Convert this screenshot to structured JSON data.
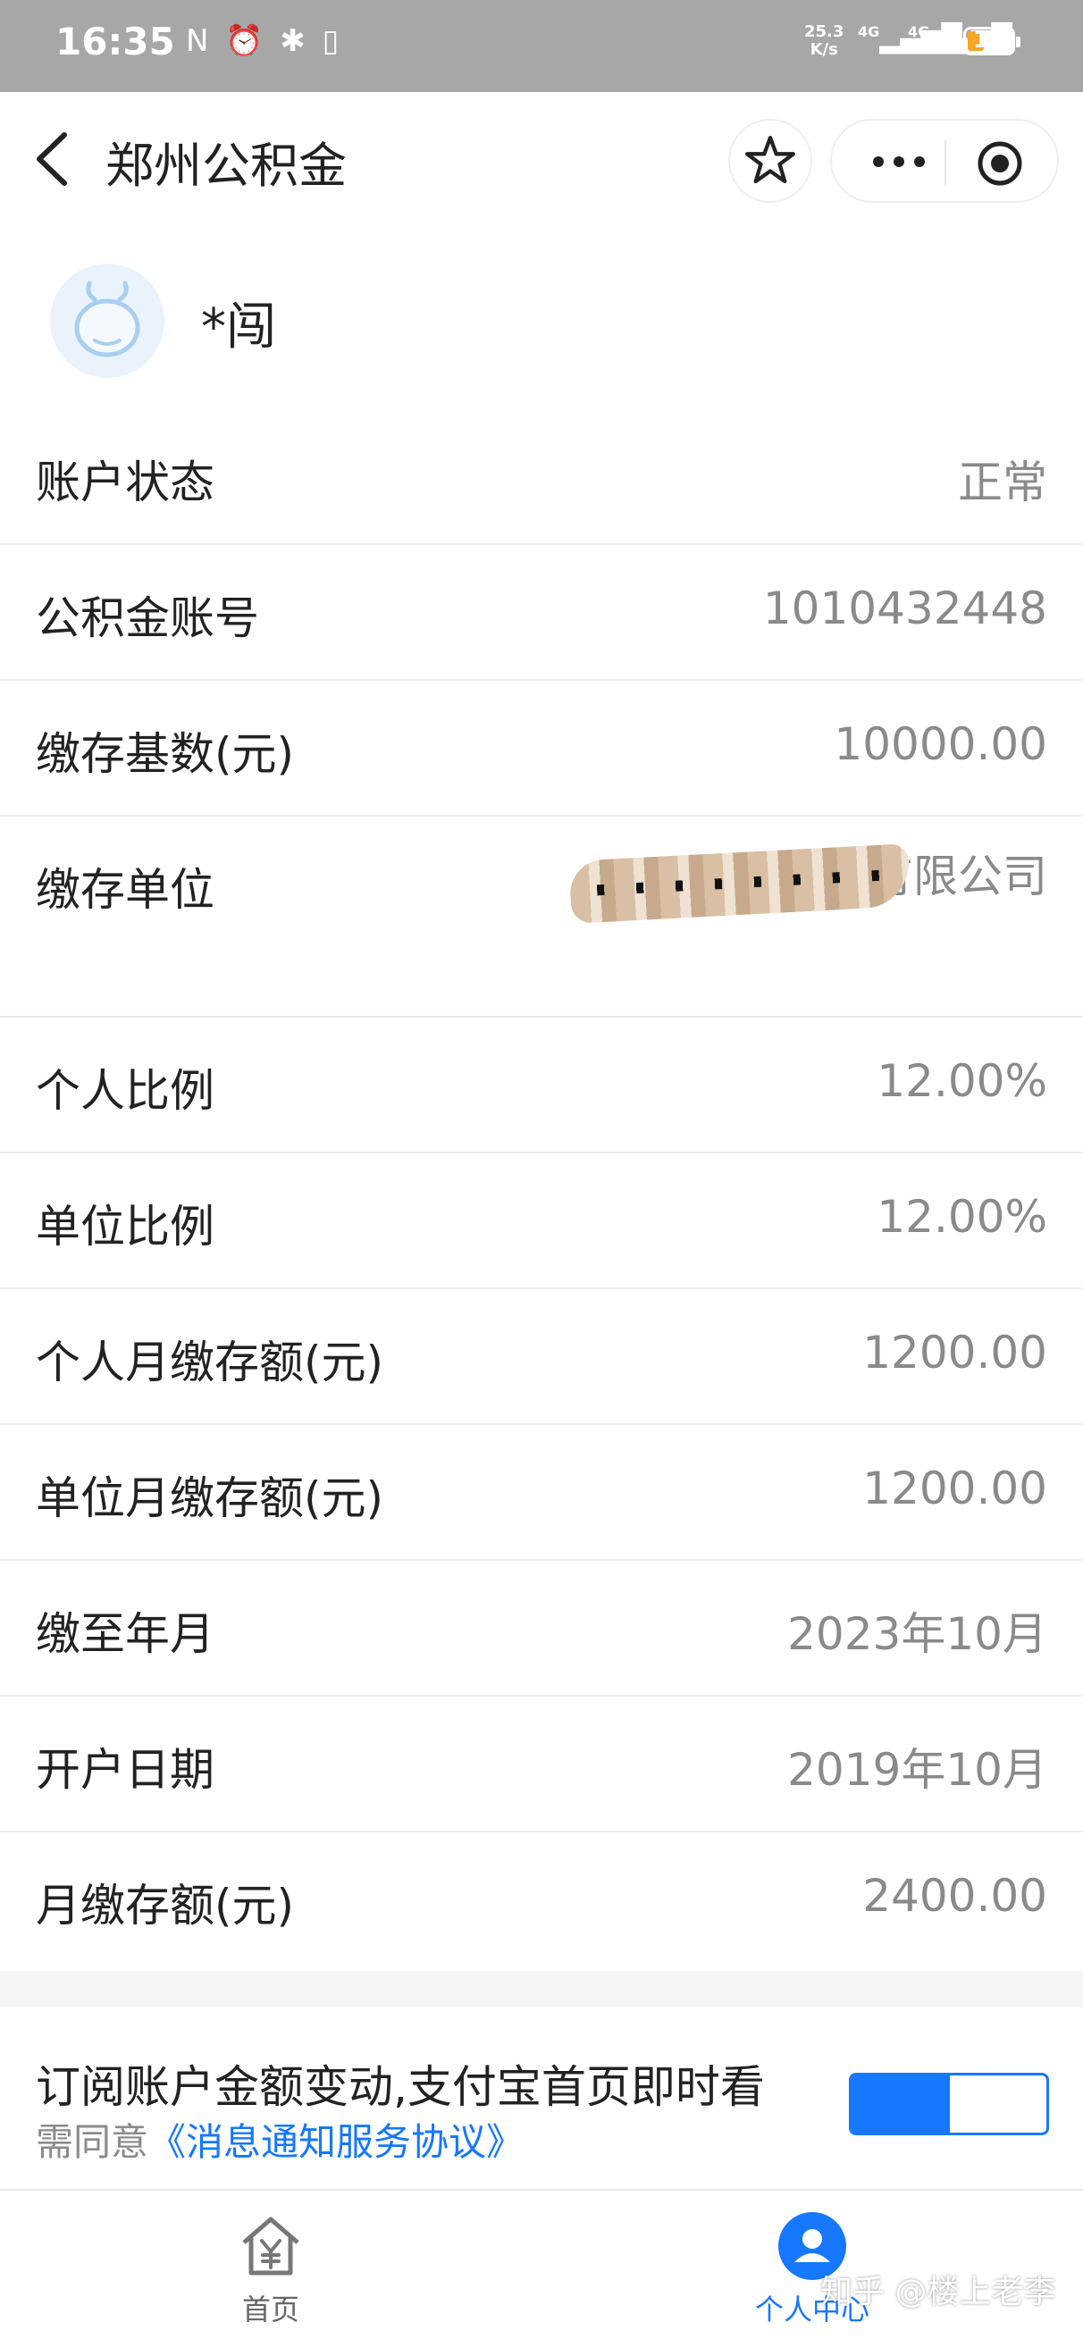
{
  "status_bar": {
    "time": "16:35",
    "left_icons": "N ⏰ ✱ ▯",
    "speed_value": "25.3",
    "speed_unit": "K/s",
    "network1": "4G",
    "network2": "4G",
    "battery": "18"
  },
  "nav": {
    "title": "郑州公积金",
    "icons": [
      "back-icon",
      "star-icon",
      "more-icon",
      "target-icon"
    ]
  },
  "user": {
    "name": "*闯"
  },
  "rows": [
    {
      "label": "账户状态",
      "value": "正常"
    },
    {
      "label": "公积金账号",
      "value": "1010432448"
    },
    {
      "label": "缴存基数(元)",
      "value": "10000.00"
    },
    {
      "label": "缴存单位",
      "value": "河南                        有限公司"
    },
    {
      "label": "个人比例",
      "value": "12.00%"
    },
    {
      "label": "单位比例",
      "value": "12.00%"
    },
    {
      "label": "个人月缴存额(元)",
      "value": "1200.00"
    },
    {
      "label": "单位月缴存额(元)",
      "value": "1200.00"
    },
    {
      "label": "缴至年月",
      "value": "2023年10月"
    },
    {
      "label": "开户日期",
      "value": "2019年10月"
    },
    {
      "label": "月缴存额(元)",
      "value": "2400.00"
    }
  ],
  "subscribe": {
    "text": "订阅账户金额变动,支付宝首页即时看",
    "sub_prefix": "需同意",
    "sub_link": "《消息通知服务协议》",
    "toggle_on": true
  },
  "tabbar": {
    "home_label": "首页",
    "profile_label": "个人中心"
  },
  "watermark": "知乎 @楼上老李",
  "colors": {
    "accent": "#1677ff",
    "status_bar": "#a7a7a7",
    "value_text": "#8a8a8a"
  }
}
